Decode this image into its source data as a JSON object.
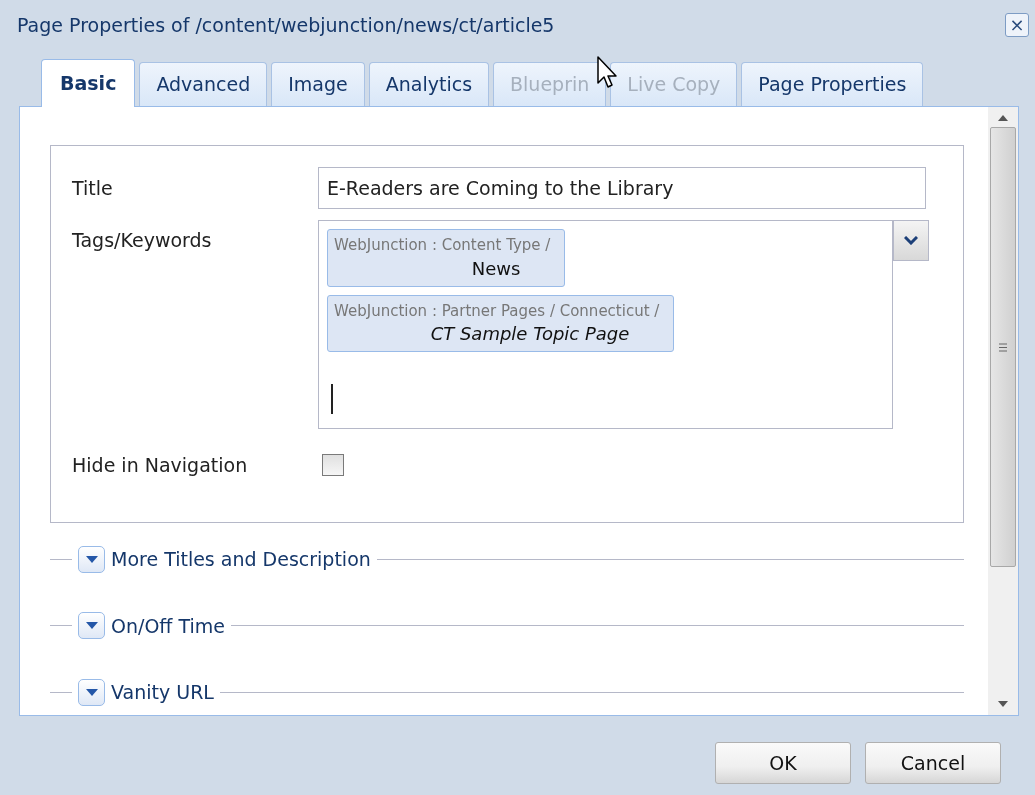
{
  "window": {
    "title": "Page Properties of /content/webjunction/news/ct/article5",
    "close": "×"
  },
  "tabs": [
    {
      "label": "Basic",
      "selected": true,
      "disabled": false
    },
    {
      "label": "Advanced",
      "selected": false,
      "disabled": false
    },
    {
      "label": "Image",
      "selected": false,
      "disabled": false
    },
    {
      "label": "Analytics",
      "selected": false,
      "disabled": false
    },
    {
      "label": "Blueprin",
      "selected": false,
      "disabled": true
    },
    {
      "label": "Live Copy",
      "selected": false,
      "disabled": true
    },
    {
      "label": "Page Properties",
      "selected": false,
      "disabled": false
    }
  ],
  "form": {
    "title": {
      "label": "Title",
      "value": "E-Readers are Coming to the Library"
    },
    "tags": {
      "label": "Tags/Keywords",
      "items": [
        {
          "path": "WebJunction : Content Type /",
          "name": "News",
          "italic": false
        },
        {
          "path": "WebJunction : Partner Pages / Connecticut /",
          "name": "CT Sample Topic Page",
          "italic": true
        }
      ]
    },
    "hide_in_navigation": {
      "label": "Hide in Navigation",
      "checked": false
    }
  },
  "sections": [
    {
      "label": "More Titles and Description",
      "expanded": false
    },
    {
      "label": "On/Off Time",
      "expanded": false
    },
    {
      "label": "Vanity URL",
      "expanded": false
    }
  ],
  "buttons": [
    "OK",
    "Cancel"
  ]
}
